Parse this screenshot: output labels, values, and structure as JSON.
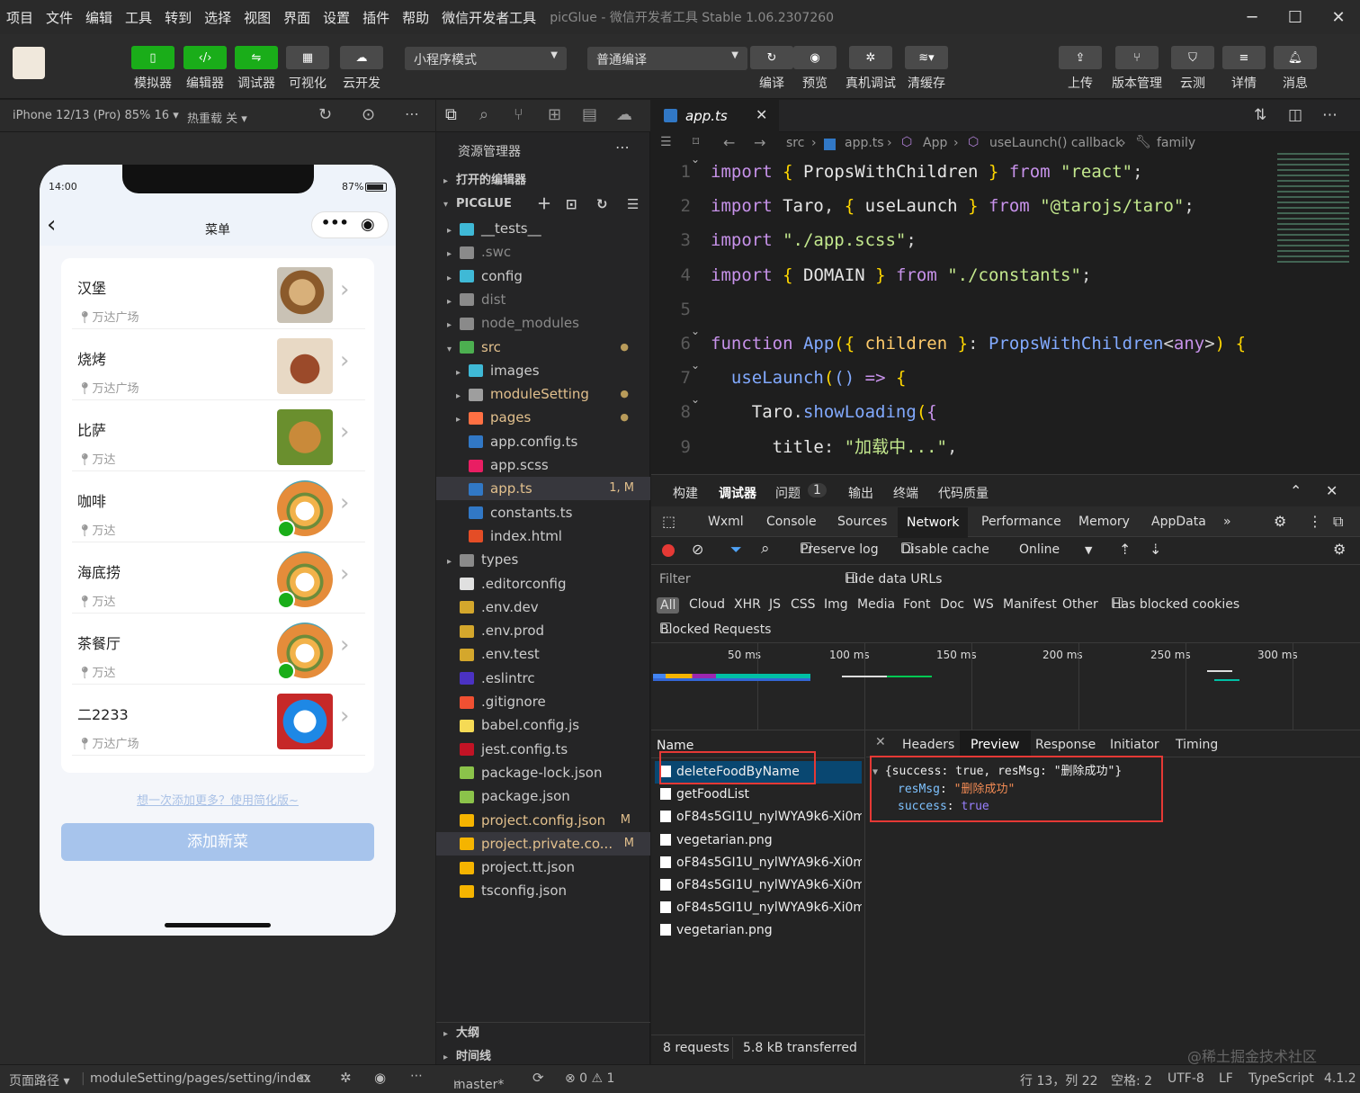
{
  "menubar": {
    "items": [
      "项目",
      "文件",
      "编辑",
      "工具",
      "转到",
      "选择",
      "视图",
      "界面",
      "设置",
      "插件",
      "帮助",
      "微信开发者工具"
    ],
    "title": "picGlue - 微信开发者工具 Stable 1.06.2307260"
  },
  "toolbar": {
    "left": [
      {
        "label": "模拟器",
        "icon": "phone-icon"
      },
      {
        "label": "编辑器",
        "icon": "code-icon"
      },
      {
        "label": "调试器",
        "icon": "debug-icon"
      },
      {
        "label": "可视化",
        "icon": "layout-icon"
      },
      {
        "label": "云开发",
        "icon": "cloud-icon"
      }
    ],
    "mode_select": "小程序模式",
    "compile_select": "普通编译",
    "middle": [
      {
        "label": "编译",
        "icon": "refresh-icon"
      },
      {
        "label": "预览",
        "icon": "eye-icon"
      },
      {
        "label": "真机调试",
        "icon": "bug-icon"
      },
      {
        "label": "清缓存",
        "icon": "layers-icon"
      }
    ],
    "right": [
      {
        "label": "上传",
        "icon": "upload-icon"
      },
      {
        "label": "版本管理",
        "icon": "branch-icon"
      },
      {
        "label": "云测",
        "icon": "test-icon"
      },
      {
        "label": "详情",
        "icon": "menu-icon"
      },
      {
        "label": "消息",
        "icon": "bell-icon"
      }
    ]
  },
  "simulator": {
    "device": "iPhone 12/13 (Pro) 85% 16 ▾",
    "hotreload": "热重载 关 ▾",
    "time": "14:00",
    "battery": "87%",
    "page_title": "菜单",
    "foods": [
      {
        "name": "汉堡",
        "location": "万达广场",
        "pic": "burger"
      },
      {
        "name": "烧烤",
        "location": "万达广场",
        "pic": "bbq"
      },
      {
        "name": "比萨",
        "location": "万达",
        "pic": "bear"
      },
      {
        "name": "咖啡",
        "location": "万达",
        "pic": "veg"
      },
      {
        "name": "海底捞",
        "location": "万达",
        "pic": "veg"
      },
      {
        "name": "茶餐厅",
        "location": "万达",
        "pic": "veg"
      },
      {
        "name": "二2233",
        "location": "万达广场",
        "pic": "doraemon"
      }
    ],
    "batch_link": "想一次添加更多？使用简化版~",
    "add_button": "添加新菜"
  },
  "explorer": {
    "title": "资源管理器",
    "open_editors": "打开的编辑器",
    "project": "PICGLUE",
    "items": [
      {
        "name": "__tests__",
        "depth": 1,
        "arrow": "▸",
        "color": "#3fb9d6"
      },
      {
        "name": ".swc",
        "depth": 1,
        "arrow": "▸",
        "color": "#8a8a8a",
        "dim": true
      },
      {
        "name": "config",
        "depth": 1,
        "arrow": "▸",
        "color": "#3fb9d6"
      },
      {
        "name": "dist",
        "depth": 1,
        "arrow": "▸",
        "color": "#8a8a8a",
        "dim": true
      },
      {
        "name": "node_modules",
        "depth": 1,
        "arrow": "▸",
        "color": "#8a8a8a",
        "dim": true
      },
      {
        "name": "src",
        "depth": 1,
        "arrow": "▾",
        "color": "#4caf50",
        "mod": true,
        "dot": true
      },
      {
        "name": "images",
        "depth": 2,
        "arrow": "▸",
        "color": "#3fb9d6"
      },
      {
        "name": "moduleSetting",
        "depth": 2,
        "arrow": "▸",
        "color": "#9e9e9e",
        "mod": true,
        "dot": true
      },
      {
        "name": "pages",
        "depth": 2,
        "arrow": "▸",
        "color": "#ff7043",
        "mod": true,
        "dot": true
      },
      {
        "name": "app.config.ts",
        "depth": 2,
        "arrow": "",
        "color": "#3178c6"
      },
      {
        "name": "app.scss",
        "depth": 2,
        "arrow": "",
        "color": "#e91e63"
      },
      {
        "name": "app.ts",
        "depth": 2,
        "arrow": "",
        "color": "#3178c6",
        "mod": true,
        "badge": "1, M",
        "selected": true
      },
      {
        "name": "constants.ts",
        "depth": 2,
        "arrow": "",
        "color": "#3178c6"
      },
      {
        "name": "index.html",
        "depth": 2,
        "arrow": "",
        "color": "#e44d26"
      },
      {
        "name": "types",
        "depth": 1,
        "arrow": "▸",
        "color": "#8a8a8a"
      },
      {
        "name": ".editorconfig",
        "depth": 1,
        "arrow": "",
        "color": "#e0e0e0"
      },
      {
        "name": ".env.dev",
        "depth": 1,
        "arrow": "",
        "color": "#d4a72c"
      },
      {
        "name": ".env.prod",
        "depth": 1,
        "arrow": "",
        "color": "#d4a72c"
      },
      {
        "name": ".env.test",
        "depth": 1,
        "arrow": "",
        "color": "#d4a72c"
      },
      {
        "name": ".eslintrc",
        "depth": 1,
        "arrow": "",
        "color": "#4b32c3"
      },
      {
        "name": ".gitignore",
        "depth": 1,
        "arrow": "",
        "color": "#f05032"
      },
      {
        "name": "babel.config.js",
        "depth": 1,
        "arrow": "",
        "color": "#f5da55"
      },
      {
        "name": "jest.config.ts",
        "depth": 1,
        "arrow": "",
        "color": "#c21325"
      },
      {
        "name": "package-lock.json",
        "depth": 1,
        "arrow": "",
        "color": "#8bc34a"
      },
      {
        "name": "package.json",
        "depth": 1,
        "arrow": "",
        "color": "#8bc34a"
      },
      {
        "name": "project.config.json",
        "depth": 1,
        "arrow": "",
        "color": "#f5b400",
        "mod": true,
        "badge": "M"
      },
      {
        "name": "project.private.co...",
        "depth": 1,
        "arrow": "",
        "color": "#f5b400",
        "mod": true,
        "badge": "M",
        "hl": true
      },
      {
        "name": "project.tt.json",
        "depth": 1,
        "arrow": "",
        "color": "#f5b400"
      },
      {
        "name": "tsconfig.json",
        "depth": 1,
        "arrow": "",
        "color": "#f5b400"
      }
    ],
    "outline": "大纲",
    "timeline": "时间线"
  },
  "editor": {
    "tab": "app.ts",
    "breadcrumb": [
      "src",
      "app.ts",
      "App",
      "useLaunch() callback",
      "family"
    ],
    "lines": [
      {
        "n": "1",
        "t": [
          [
            "kw",
            "import"
          ],
          [
            "pun",
            " "
          ],
          [
            "brk",
            "{"
          ],
          [
            "pun",
            " "
          ],
          [
            "id",
            "PropsWithChildren"
          ],
          [
            "pun",
            " "
          ],
          [
            "brk",
            "}"
          ],
          [
            "pun",
            " "
          ],
          [
            "kw",
            "from"
          ],
          [
            "pun",
            " "
          ],
          [
            "str",
            "\"react\""
          ],
          [
            "pun",
            ";"
          ]
        ]
      },
      {
        "n": "2",
        "t": [
          [
            "kw",
            "import"
          ],
          [
            "pun",
            " "
          ],
          [
            "id",
            "Taro"
          ],
          [
            "pun",
            ", "
          ],
          [
            "brk",
            "{"
          ],
          [
            "pun",
            " "
          ],
          [
            "id",
            "useLaunch"
          ],
          [
            "pun",
            " "
          ],
          [
            "brk",
            "}"
          ],
          [
            "pun",
            " "
          ],
          [
            "kw",
            "from"
          ],
          [
            "pun",
            " "
          ],
          [
            "str",
            "\"@tarojs/taro\""
          ],
          [
            "pun",
            ";"
          ]
        ]
      },
      {
        "n": "3",
        "t": [
          [
            "kw",
            "import"
          ],
          [
            "pun",
            " "
          ],
          [
            "str",
            "\"./app.scss\""
          ],
          [
            "pun",
            ";"
          ]
        ]
      },
      {
        "n": "4",
        "t": [
          [
            "kw",
            "import"
          ],
          [
            "pun",
            " "
          ],
          [
            "brk",
            "{"
          ],
          [
            "pun",
            " "
          ],
          [
            "id",
            "DOMAIN"
          ],
          [
            "pun",
            " "
          ],
          [
            "brk",
            "}"
          ],
          [
            "pun",
            " "
          ],
          [
            "kw",
            "from"
          ],
          [
            "pun",
            " "
          ],
          [
            "str",
            "\"./constants\""
          ],
          [
            "pun",
            ";"
          ]
        ]
      },
      {
        "n": "5",
        "t": []
      },
      {
        "n": "6",
        "t": [
          [
            "kw",
            "function"
          ],
          [
            "pun",
            " "
          ],
          [
            "fn",
            "App"
          ],
          [
            "brk",
            "("
          ],
          [
            "brk",
            "{"
          ],
          [
            "pun",
            " "
          ],
          [
            "ty",
            "children"
          ],
          [
            "pun",
            " "
          ],
          [
            "brk",
            "}"
          ],
          [
            "pun",
            ": "
          ],
          [
            "fn",
            "PropsWithChildren"
          ],
          [
            "pun",
            "<"
          ],
          [
            "kw",
            "any"
          ],
          [
            "pun",
            ">"
          ],
          [
            "brk",
            ")"
          ],
          [
            "pun",
            " "
          ],
          [
            "brk",
            "{"
          ]
        ]
      },
      {
        "n": "7",
        "t": [
          [
            "pun",
            "  "
          ],
          [
            "fn",
            "useLaunch"
          ],
          [
            "brk",
            "("
          ],
          [
            "fn",
            "()"
          ],
          [
            "pun",
            " "
          ],
          [
            "kw",
            "=>"
          ],
          [
            "pun",
            " "
          ],
          [
            "brk",
            "{"
          ]
        ]
      },
      {
        "n": "8",
        "t": [
          [
            "pun",
            "    "
          ],
          [
            "id",
            "Taro"
          ],
          [
            "pun",
            "."
          ],
          [
            "fn",
            "showLoading"
          ],
          [
            "brk",
            "("
          ],
          [
            "kw",
            "{"
          ]
        ]
      },
      {
        "n": "9",
        "t": [
          [
            "pun",
            "      "
          ],
          [
            "id",
            "title"
          ],
          [
            "pun",
            ": "
          ],
          [
            "str",
            "\"加载中...\""
          ],
          [
            "pun",
            ","
          ]
        ]
      }
    ]
  },
  "devtools": {
    "panel_tabs": [
      "构建",
      "调试器",
      "问题",
      "输出",
      "终端",
      "代码质量"
    ],
    "problems_count": "1",
    "tabs": [
      "Wxml",
      "Console",
      "Sources",
      "Network",
      "Performance",
      "Memory",
      "AppData"
    ],
    "preserve_log": "Preserve log",
    "disable_cache": "Disable cache",
    "throttle": "Online",
    "filter_label": "Filter",
    "hide_data_urls": "Hide data URLs",
    "types": [
      "All",
      "Cloud",
      "XHR",
      "JS",
      "CSS",
      "Img",
      "Media",
      "Font",
      "Doc",
      "WS",
      "Manifest",
      "Other"
    ],
    "has_blocked_cookies": "Has blocked cookies",
    "blocked_requests": "Blocked Requests",
    "timeline_ticks": [
      "50 ms",
      "100 ms",
      "150 ms",
      "200 ms",
      "250 ms",
      "300 ms"
    ],
    "name_header": "Name",
    "requests": [
      {
        "name": "deleteFoodByName",
        "selected": true
      },
      {
        "name": "getFoodList"
      },
      {
        "name": "oF84s5GI1U_nylWYA9k6-Xi0m..."
      },
      {
        "name": "vegetarian.png"
      },
      {
        "name": "oF84s5GI1U_nylWYA9k6-Xi0m..."
      },
      {
        "name": "oF84s5GI1U_nylWYA9k6-Xi0m..."
      },
      {
        "name": "oF84s5GI1U_nylWYA9k6-Xi0m..."
      },
      {
        "name": "vegetarian.png"
      }
    ],
    "detail_tabs": [
      "Headers",
      "Preview",
      "Response",
      "Initiator",
      "Timing"
    ],
    "preview": {
      "summary": "{success: true, resMsg: \"删除成功\"}",
      "resMsg_key": "resMsg",
      "resMsg_val": "\"删除成功\"",
      "success_key": "success",
      "success_val": "true"
    },
    "footer_requests": "8 requests",
    "footer_transferred": "5.8 kB transferred"
  },
  "statusbar": {
    "page_path_label": "页面路径 ▾",
    "page_path": "moduleSetting/pages/setting/index",
    "branch": "master*",
    "errors": "⊗ 0 ⚠ 1",
    "position": "行 13，列 22",
    "spaces": "空格: 2",
    "encoding": "UTF-8",
    "eol": "LF",
    "language": "TypeScript",
    "version": "4.1.2"
  },
  "watermark": "@稀土掘金技术社区",
  "colors": {
    "accent_green": "#1aad19",
    "selection_blue": "#094771",
    "highlight_red": "#e53935"
  }
}
